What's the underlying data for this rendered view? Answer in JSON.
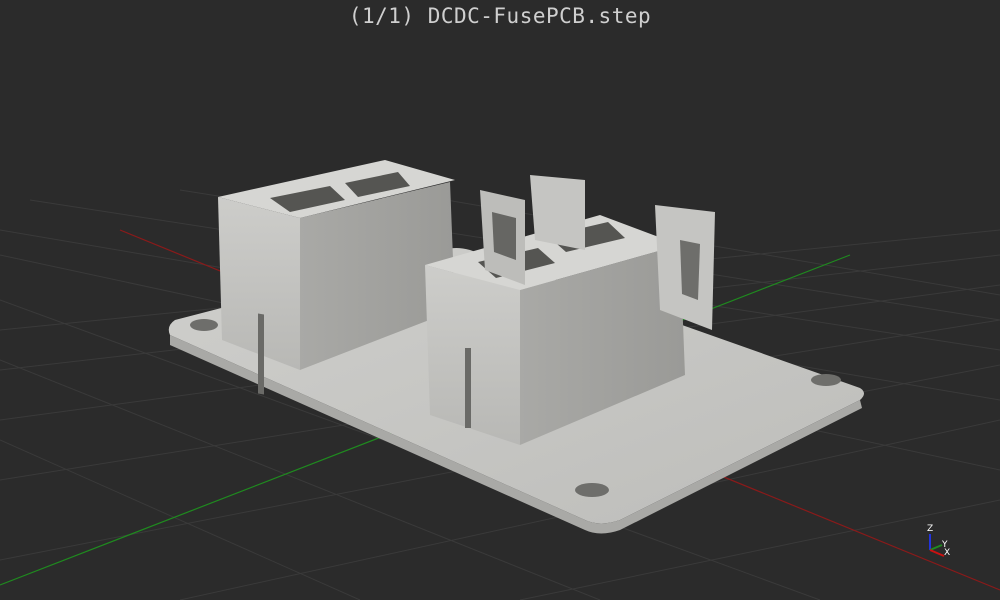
{
  "window": {
    "title": "(1/1) DCDC-FusePCB.step"
  },
  "orientation_gizmo": {
    "z_label": "Z",
    "y_label": "Y",
    "x_label": "X"
  },
  "colors": {
    "background": "#2b2b2b",
    "grid": "#3a3a3a",
    "x_axis": "#8a1a1a",
    "y_axis": "#1f8a1f",
    "z_axis": "#2233dd",
    "model": "#c9c9c6"
  },
  "icons": [
    "axis-gizmo-icon"
  ]
}
